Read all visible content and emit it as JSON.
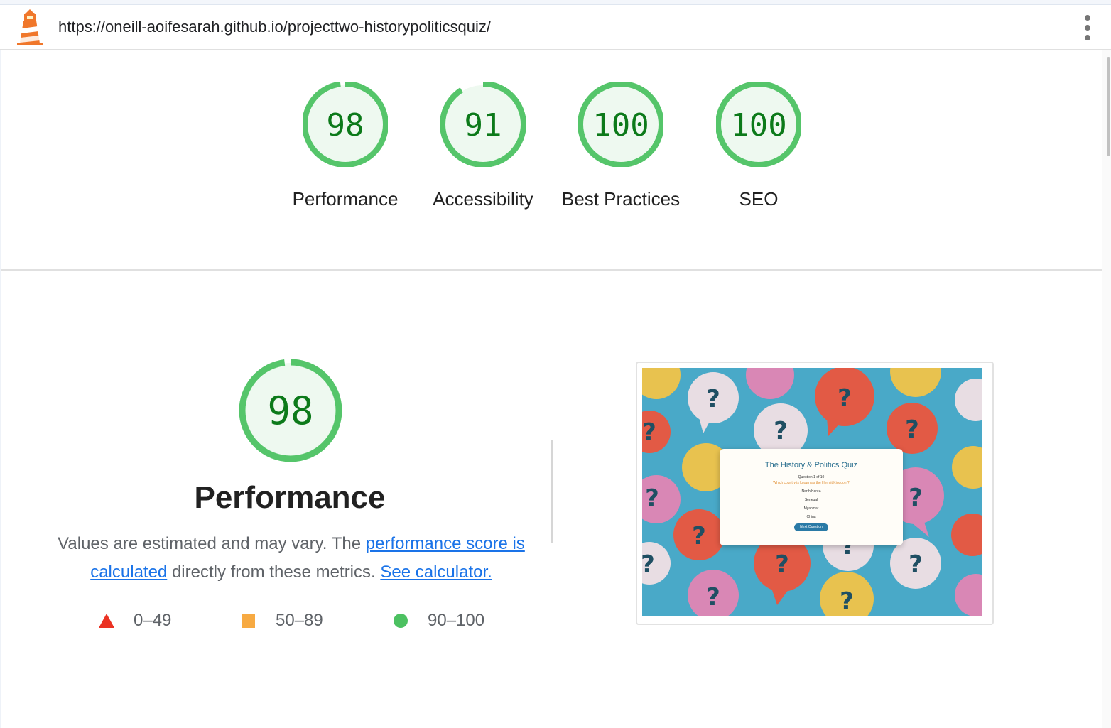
{
  "header": {
    "url": "https://oneill-aoifesarah.github.io/projecttwo-historypoliticsquiz/",
    "menu_icon": "kebab-menu-icon",
    "logo_icon": "lighthouse-icon"
  },
  "gauges": [
    {
      "score": "98",
      "value": 98,
      "label": "Performance"
    },
    {
      "score": "91",
      "value": 91,
      "label": "Accessibility"
    },
    {
      "score": "100",
      "value": 100,
      "label": "Best Practices"
    },
    {
      "score": "100",
      "value": 100,
      "label": "SEO"
    }
  ],
  "performance": {
    "score": "98",
    "value": 98,
    "title": "Performance",
    "desc_part1": "Values are estimated and may vary. The ",
    "desc_link1": "performance score is calculated",
    "desc_part2": " directly from these metrics. ",
    "desc_link2": "See calculator."
  },
  "legend": [
    {
      "range": "0–49",
      "shape": "triangle",
      "color": "#eb3223"
    },
    {
      "range": "50–89",
      "shape": "square",
      "color": "#f7aa42"
    },
    {
      "range": "90–100",
      "shape": "circle",
      "color": "#4cc161"
    }
  ],
  "screenshot": {
    "title": "The History & Politics Quiz",
    "question_count": "Question 1 of 10",
    "question": "Which country is known as the Hermit Kingdom?",
    "options": [
      "North Korea",
      "Senegal",
      "Myanmar",
      "China"
    ],
    "button": "Next Question"
  },
  "colors": {
    "pass_stroke": "#0cce6b",
    "pass_text": "#0c7a1a",
    "pass_fill": "#e8f7ec"
  }
}
